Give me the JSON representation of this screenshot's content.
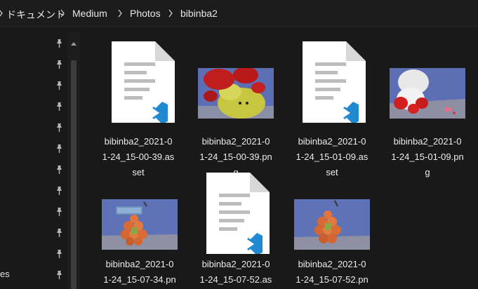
{
  "breadcrumb": {
    "items": [
      "ドキュメント",
      "Medium",
      "Photos",
      "bibinba2"
    ]
  },
  "nav": {
    "partial_label": "es",
    "pinned_count": 12
  },
  "files": [
    {
      "type": "asset",
      "line1": "bibinba2_2021-0",
      "line2": "1-24_15-00-39.as",
      "line3": "set"
    },
    {
      "type": "png",
      "line1": "bibinba2_2021-0",
      "line2": "1-24_15-00-39.pn",
      "line3": "g"
    },
    {
      "type": "asset",
      "line1": "bibinba2_2021-0",
      "line2": "1-24_15-01-09.as",
      "line3": "set"
    },
    {
      "type": "png",
      "line1": "bibinba2_2021-0",
      "line2": "1-24_15-01-09.pn",
      "line3": "g"
    },
    {
      "type": "png",
      "line1": "bibinba2_2021-0",
      "line2": "1-24_15-07-34.pn",
      "line3": ""
    },
    {
      "type": "asset",
      "line1": "bibinba2_2021-0",
      "line2": "1-24_15-07-52.as",
      "line3": ""
    },
    {
      "type": "png",
      "line1": "bibinba2_2021-0",
      "line2": "1-24_15-07-52.pn",
      "line3": ""
    }
  ],
  "icons": {
    "chevron": "chevron-right-icon",
    "pin": "pin-icon",
    "vscode": "vscode-icon"
  },
  "colors": {
    "background": "#191919",
    "vscode_blue": "#1f8ad2",
    "photo_sky": "#5c6fb5",
    "doc_white": "#ffffff"
  }
}
